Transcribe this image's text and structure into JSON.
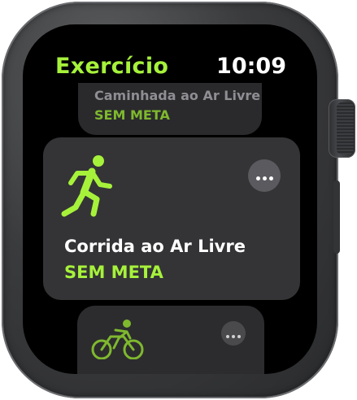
{
  "header": {
    "app_title": "Exercício",
    "time": "10:09"
  },
  "workouts": [
    {
      "name": "Caminhada ao Ar Livre",
      "goal": "SEM META",
      "icon": "walking-icon"
    },
    {
      "name": "Corrida ao Ar Livre",
      "goal": "SEM META",
      "icon": "running-icon"
    },
    {
      "name": "",
      "goal": "",
      "icon": "cycling-icon"
    }
  ],
  "colors": {
    "accent": "#a6f23b",
    "card": "#343436",
    "screen": "#000000"
  }
}
